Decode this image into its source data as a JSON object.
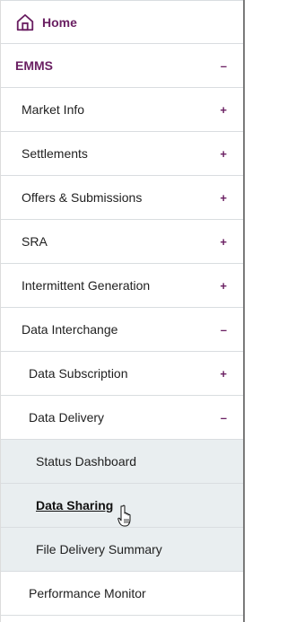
{
  "nav": {
    "home": {
      "label": "Home",
      "icon": "home-icon"
    },
    "items": [
      {
        "label": "EMMS",
        "toggle": "–"
      },
      {
        "label": "Market Info",
        "toggle": "+"
      },
      {
        "label": "Settlements",
        "toggle": "+"
      },
      {
        "label": "Offers & Submissions",
        "toggle": "+"
      },
      {
        "label": "SRA",
        "toggle": "+"
      },
      {
        "label": "Intermittent Generation",
        "toggle": "+"
      },
      {
        "label": "Data Interchange",
        "toggle": "–"
      },
      {
        "label": "Data Subscription",
        "toggle": "+"
      },
      {
        "label": "Data Delivery",
        "toggle": "–"
      },
      {
        "label": "Status Dashboard"
      },
      {
        "label": "Data Sharing"
      },
      {
        "label": "File Delivery Summary"
      },
      {
        "label": "Performance Monitor"
      }
    ]
  },
  "colors": {
    "accent": "#6a1f62",
    "submenu_bg": "#e9eef0"
  }
}
